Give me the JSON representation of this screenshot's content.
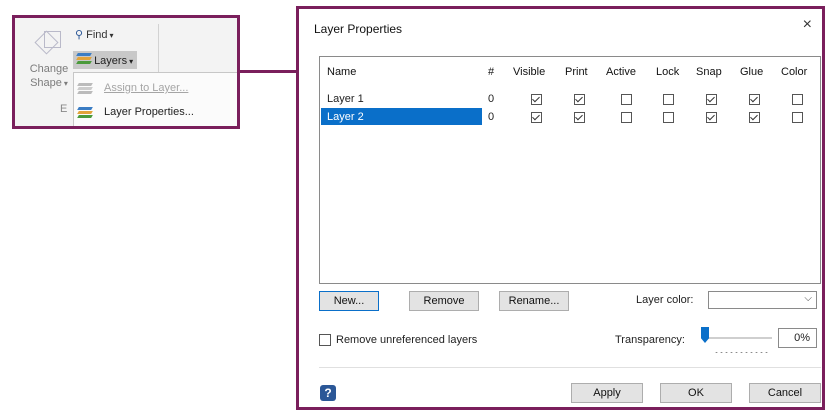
{
  "ribbon": {
    "change_shape_line1": "Change",
    "change_shape_line2": "Shape",
    "find_label": "Find",
    "layers_label": "Layers",
    "group_label": "E",
    "menu": {
      "assign": "Assign to Layer...",
      "properties": "Layer Properties..."
    }
  },
  "dialog": {
    "title": "Layer Properties",
    "close": "×",
    "columns": [
      "Name",
      "#",
      "Visible",
      "Print",
      "Active",
      "Lock",
      "Snap",
      "Glue",
      "Color"
    ],
    "rows": [
      {
        "name": "Layer 1",
        "count": "0",
        "visible": true,
        "print": true,
        "active": false,
        "lock": false,
        "snap": true,
        "glue": true,
        "color": false,
        "selected": false
      },
      {
        "name": "Layer 2",
        "count": "0",
        "visible": true,
        "print": true,
        "active": false,
        "lock": false,
        "snap": true,
        "glue": true,
        "color": false,
        "selected": true
      }
    ],
    "buttons": {
      "new": "New...",
      "remove": "Remove",
      "rename": "Rename...",
      "apply": "Apply",
      "ok": "OK",
      "cancel": "Cancel"
    },
    "layer_color_label": "Layer color:",
    "layer_color_value": "",
    "remove_unreferenced_label": "Remove unreferenced layers",
    "remove_unreferenced_checked": false,
    "transparency_label": "Transparency:",
    "transparency_value": "0%",
    "help": "?"
  },
  "colors": {
    "accent_frame": "#7a1f5c",
    "selection": "#0a6fc9"
  }
}
